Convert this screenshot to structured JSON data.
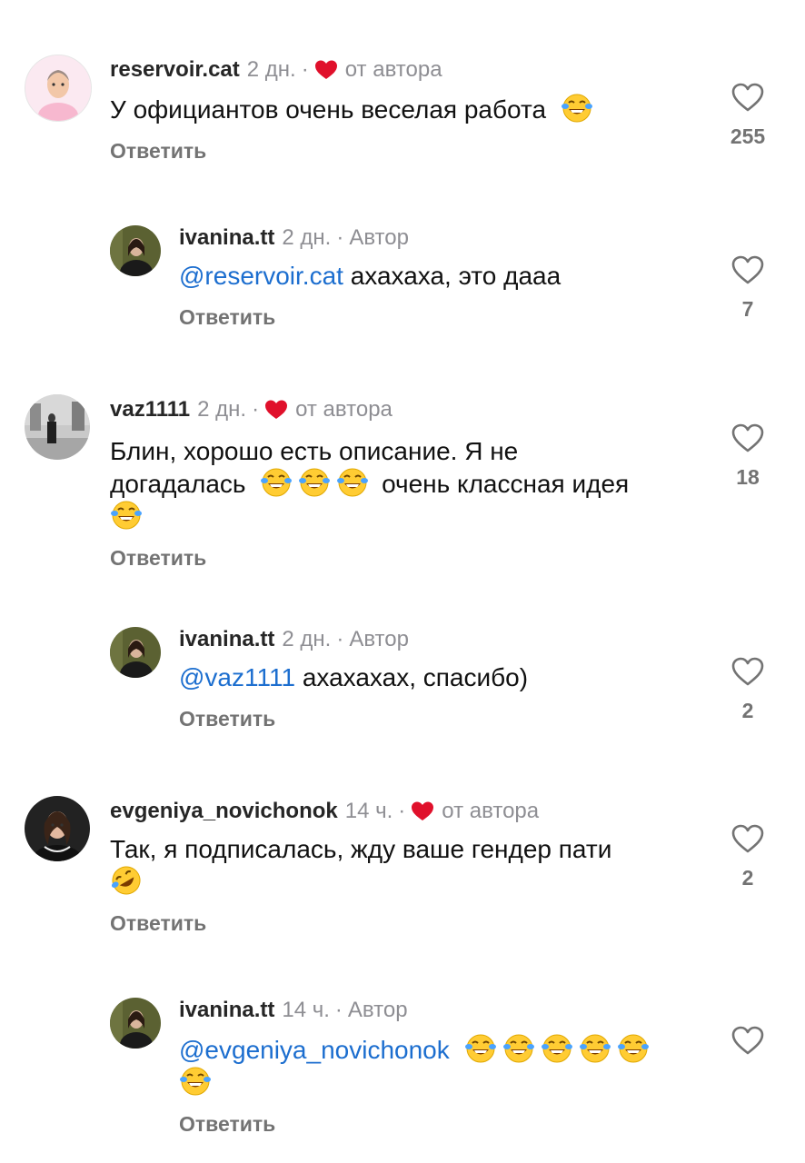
{
  "colors": {
    "mention": "#1c6ecf",
    "heart": "#e0102b",
    "muted": "#8e8e93"
  },
  "emoji_names": {
    "laugh": "face-with-tears-of-joy",
    "rofl": "rolling-on-floor-laughing"
  },
  "comments": [
    {
      "username": "reservoir.cat",
      "time": "2 дн.",
      "sep": "·",
      "author_label": "от автора",
      "text": "У официантов очень веселая работа",
      "emojis_after": [
        "laugh"
      ],
      "reply_label": "Ответить",
      "likes": "255"
    },
    {
      "username": "ivanina.tt",
      "time": "2 дн.",
      "sep": "·",
      "author_label": "Автор",
      "mention": "@reservoir.cat",
      "text": "ахахаха, это дааа",
      "reply_label": "Ответить",
      "likes": "7"
    },
    {
      "username": "vaz1111",
      "time": "2 дн.",
      "sep": "·",
      "author_label": "от автора",
      "text_line1": "Блин, хорошо есть описание. Я не",
      "text_line2a": "догадалась",
      "text_line2b": "очень классная идея",
      "reply_label": "Ответить",
      "likes": "18"
    },
    {
      "username": "ivanina.tt",
      "time": "2 дн.",
      "sep": "·",
      "author_label": "Автор",
      "mention": "@vaz1111",
      "text": "ахахахах, спасибо)",
      "reply_label": "Ответить",
      "likes": "2"
    },
    {
      "username": "evgeniya_novichonok",
      "time": "14 ч.",
      "sep": "·",
      "author_label": "от автора",
      "text": "Так, я подписалась, жду ваше гендер пати",
      "reply_label": "Ответить",
      "likes": "2"
    },
    {
      "username": "ivanina.tt",
      "time": "14 ч.",
      "sep": "·",
      "author_label": "Автор",
      "mention": "@evgeniya_novichonok",
      "reply_label": "Ответить",
      "likes": ""
    }
  ]
}
